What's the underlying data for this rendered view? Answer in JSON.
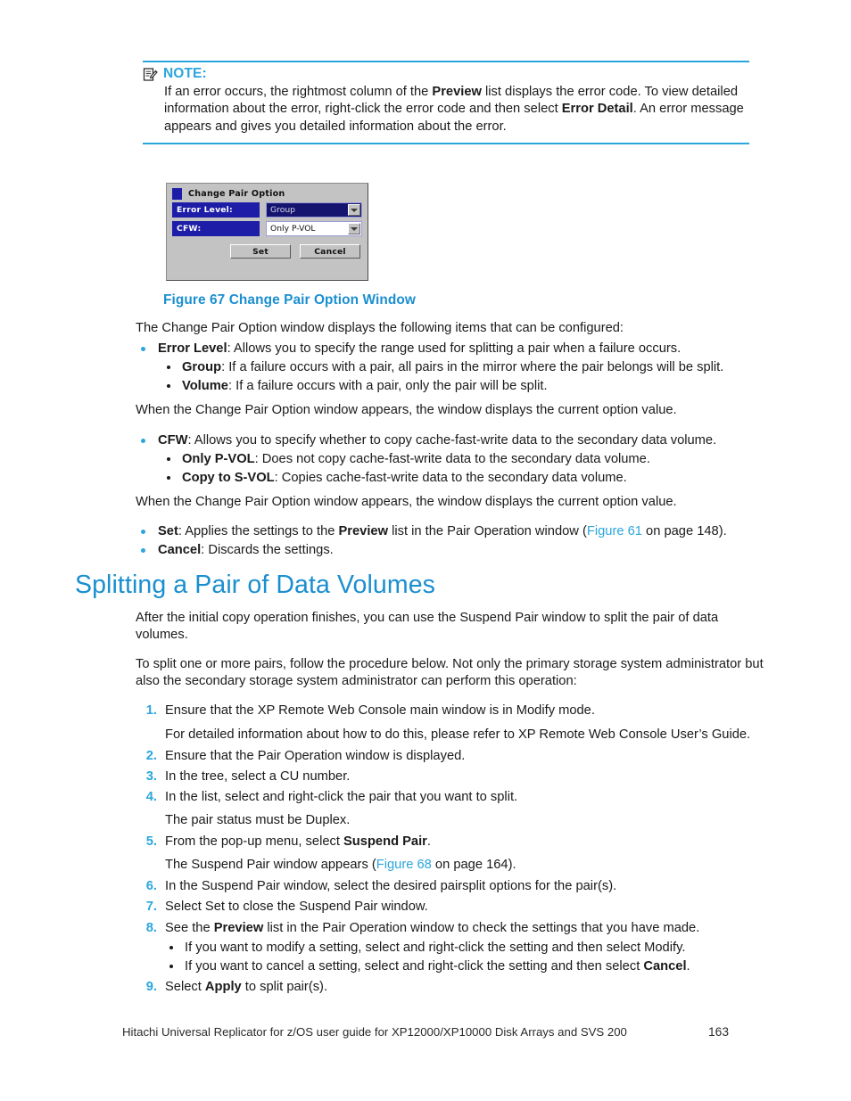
{
  "note": {
    "icon": "note-pencil-icon",
    "label": "NOTE:",
    "body_pre_1": "If an error occurs, the rightmost column of the ",
    "body_bold_1": "Preview",
    "body_mid_1": " list displays the error code. To view detailed information about the error, right-click the error code and then select ",
    "body_bold_2": "Error Detail",
    "body_post": ". An error message appears and gives you detailed information about the error."
  },
  "screenshot": {
    "title": "Change Pair Option",
    "system_icon": "window-system-icon",
    "rows": [
      {
        "label": "Error Level:",
        "value": "Group",
        "state": "selected"
      },
      {
        "label": "CFW:",
        "value": "Only P-VOL",
        "state": "plain"
      }
    ],
    "buttons": [
      {
        "label": "Set"
      },
      {
        "label": "Cancel"
      }
    ]
  },
  "figure_caption": "Figure 67 Change Pair Option Window",
  "intro": "The Change Pair Option window displays the following items that can be configured:",
  "items": {
    "error_level_term": "Error Level",
    "error_level_desc": ": Allows you to specify the range used for splitting a pair when a failure occurs.",
    "group_term": "Group",
    "group_desc": ": If a failure occurs with a pair, all pairs in the mirror where the pair belongs will be split.",
    "volume_term": "Volume",
    "volume_desc": ": If a failure occurs with a pair, only the pair will be split.",
    "note_after_error_level": "When the Change Pair Option window appears, the window displays the current option value.",
    "cfw_term": "CFW",
    "cfw_desc": ": Allows you to specify whether to copy cache-fast-write data to the secondary data volume.",
    "only_pvol_term": "Only P-VOL",
    "only_pvol_desc": ": Does not copy cache-fast-write data to the secondary data volume.",
    "copy_svol_term": "Copy to S-VOL",
    "copy_svol_desc": ": Copies cache-fast-write data to the secondary data volume.",
    "note_after_cfw": "When the Change Pair Option window appears, the window displays the current option value.",
    "set_term": "Set",
    "set_desc_pre": ": Applies the settings to the ",
    "set_desc_bold": "Preview",
    "set_desc_mid": " list in the Pair Operation window (",
    "set_desc_link": "Figure 61",
    "set_desc_post": " on page 148).",
    "cancel_term": "Cancel",
    "cancel_desc": ": Discards the settings."
  },
  "section_heading": "Splitting a Pair of Data Volumes",
  "section_paras": {
    "p1": "After the initial copy operation finishes, you can use the Suspend Pair window to split the pair of data volumes.",
    "p2": "To split one or more pairs, follow the procedure below.  Not only the primary storage system administrator but also the secondary storage system administrator can perform this operation:"
  },
  "steps": [
    {
      "num": "1.",
      "text": "Ensure that the XP Remote Web Console main window is in Modify mode."
    },
    {
      "num": "2.",
      "text": "Ensure that the Pair Operation window is displayed."
    },
    {
      "num": "3.",
      "text": "In the tree, select a CU number."
    },
    {
      "num": "4.",
      "text": "In the list, select and right-click the pair that you want to split."
    },
    {
      "num": "5.",
      "text": "From the pop-up menu, select "
    },
    {
      "num": "6.",
      "text": "In the Suspend Pair window, select the desired pairsplit options for the pair(s)."
    },
    {
      "num": "7.",
      "text": "Select Set to close the Suspend Pair window."
    },
    {
      "num": "8.",
      "text": "See the "
    },
    {
      "num": "9.",
      "text": "Select "
    }
  ],
  "step_details": {
    "step1_sub": "For detailed information about how to do this, please refer to XP Remote Web Console User’s Guide.",
    "step4_sub": "The pair status must be Duplex.",
    "step5_bold": "Suspend Pair",
    "step5_end": ".",
    "step5_sub_pre": "The Suspend Pair window appears (",
    "step5_sub_link": "Figure 68",
    "step5_sub_post": " on page 164).",
    "step8_bold": "Preview",
    "step8_rest": " list in the Pair Operation window to check the settings that you have made.",
    "step8_bullet1": "If you want to modify a setting, select and right-click the setting and then select Modify.",
    "step8_bullet2_pre": "If you want to cancel a setting, select and right-click the setting and then select ",
    "step8_bullet2_bold": "Cancel",
    "step8_bullet2_post": ".",
    "step9_bold": "Apply",
    "step9_rest": " to split pair(s)."
  },
  "footer": {
    "text": "Hitachi Universal Replicator for z/OS user guide for XP12000/XP10000 Disk Arrays and SVS 200",
    "page": "163"
  },
  "colors": {
    "accent_blue": "#2ba6dd",
    "heading_blue": "#1a8fd0",
    "dialog_navy": "#1d1da8",
    "dialog_face": "#c3c3c3"
  }
}
